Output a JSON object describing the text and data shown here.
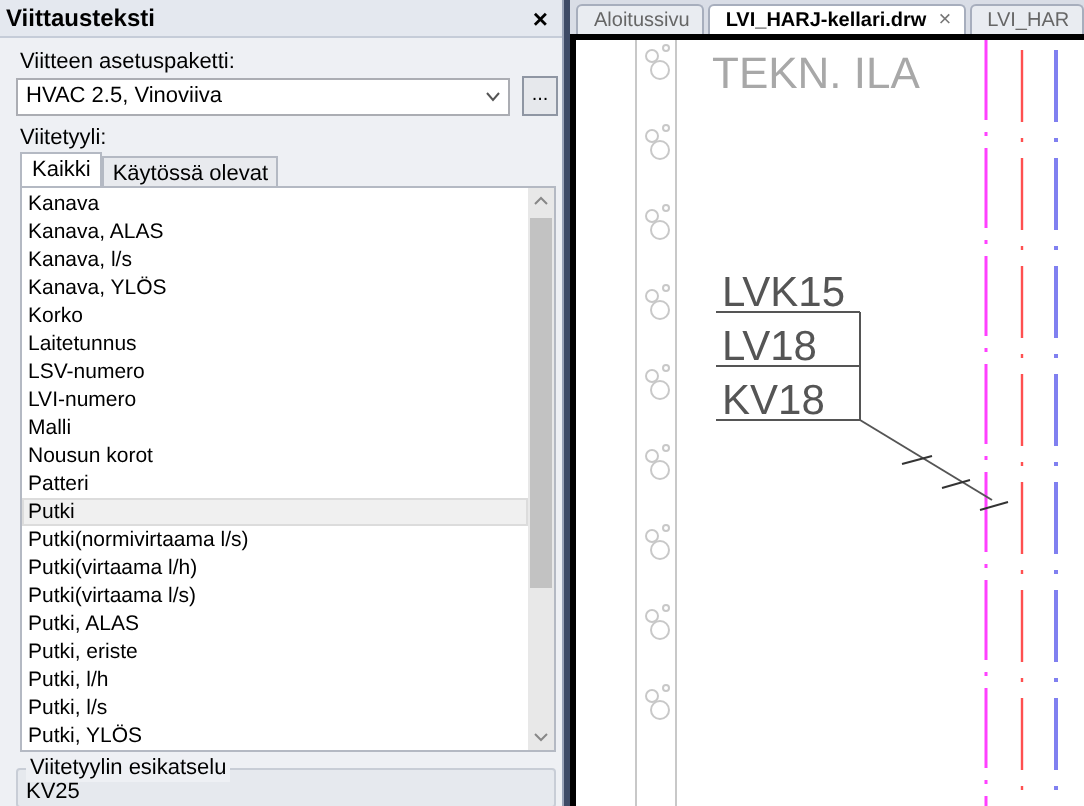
{
  "panel": {
    "title": "Viittausteksti",
    "close": "×",
    "package_label": "Viitteen asetuspaketti:",
    "package_value": "HVAC 2.5, Vinoviiva",
    "browse": "...",
    "style_label": "Viitetyyli:",
    "tabs": [
      {
        "label": "Kaikki",
        "selected": true
      },
      {
        "label": "Käytössä olevat",
        "selected": false
      }
    ],
    "styles": [
      {
        "label": "Kanava",
        "selected": false
      },
      {
        "label": "Kanava, ALAS",
        "selected": false
      },
      {
        "label": "Kanava, l/s",
        "selected": false
      },
      {
        "label": "Kanava, YLÖS",
        "selected": false
      },
      {
        "label": "Korko",
        "selected": false
      },
      {
        "label": "Laitetunnus",
        "selected": false
      },
      {
        "label": "LSV-numero",
        "selected": false
      },
      {
        "label": "LVI-numero",
        "selected": false
      },
      {
        "label": "Malli",
        "selected": false
      },
      {
        "label": "Nousun korot",
        "selected": false
      },
      {
        "label": "Patteri",
        "selected": false
      },
      {
        "label": "Putki",
        "selected": true
      },
      {
        "label": "Putki(normivirtaama l/s)",
        "selected": false
      },
      {
        "label": "Putki(virtaama l/h)",
        "selected": false
      },
      {
        "label": "Putki(virtaama l/s)",
        "selected": false
      },
      {
        "label": "Putki, ALAS",
        "selected": false
      },
      {
        "label": "Putki, eriste",
        "selected": false
      },
      {
        "label": "Putki, l/h",
        "selected": false
      },
      {
        "label": "Putki, l/s",
        "selected": false
      },
      {
        "label": "Putki, YLÖS",
        "selected": false
      }
    ],
    "preview_label": "Viitetyylin esikatselu",
    "preview_value": "KV25"
  },
  "documents": {
    "tabs": [
      {
        "label": "Aloitussivu",
        "selected": false,
        "closable": false
      },
      {
        "label": "LVI_HARJ-kellari.drw",
        "selected": true,
        "closable": true,
        "close": "×"
      },
      {
        "label": "LVI_HAR",
        "selected": false,
        "closable": false
      }
    ],
    "drawing": {
      "room_text": "TEKN. ILA",
      "labels": [
        "LVK15",
        "LV18",
        "KV18"
      ]
    }
  }
}
